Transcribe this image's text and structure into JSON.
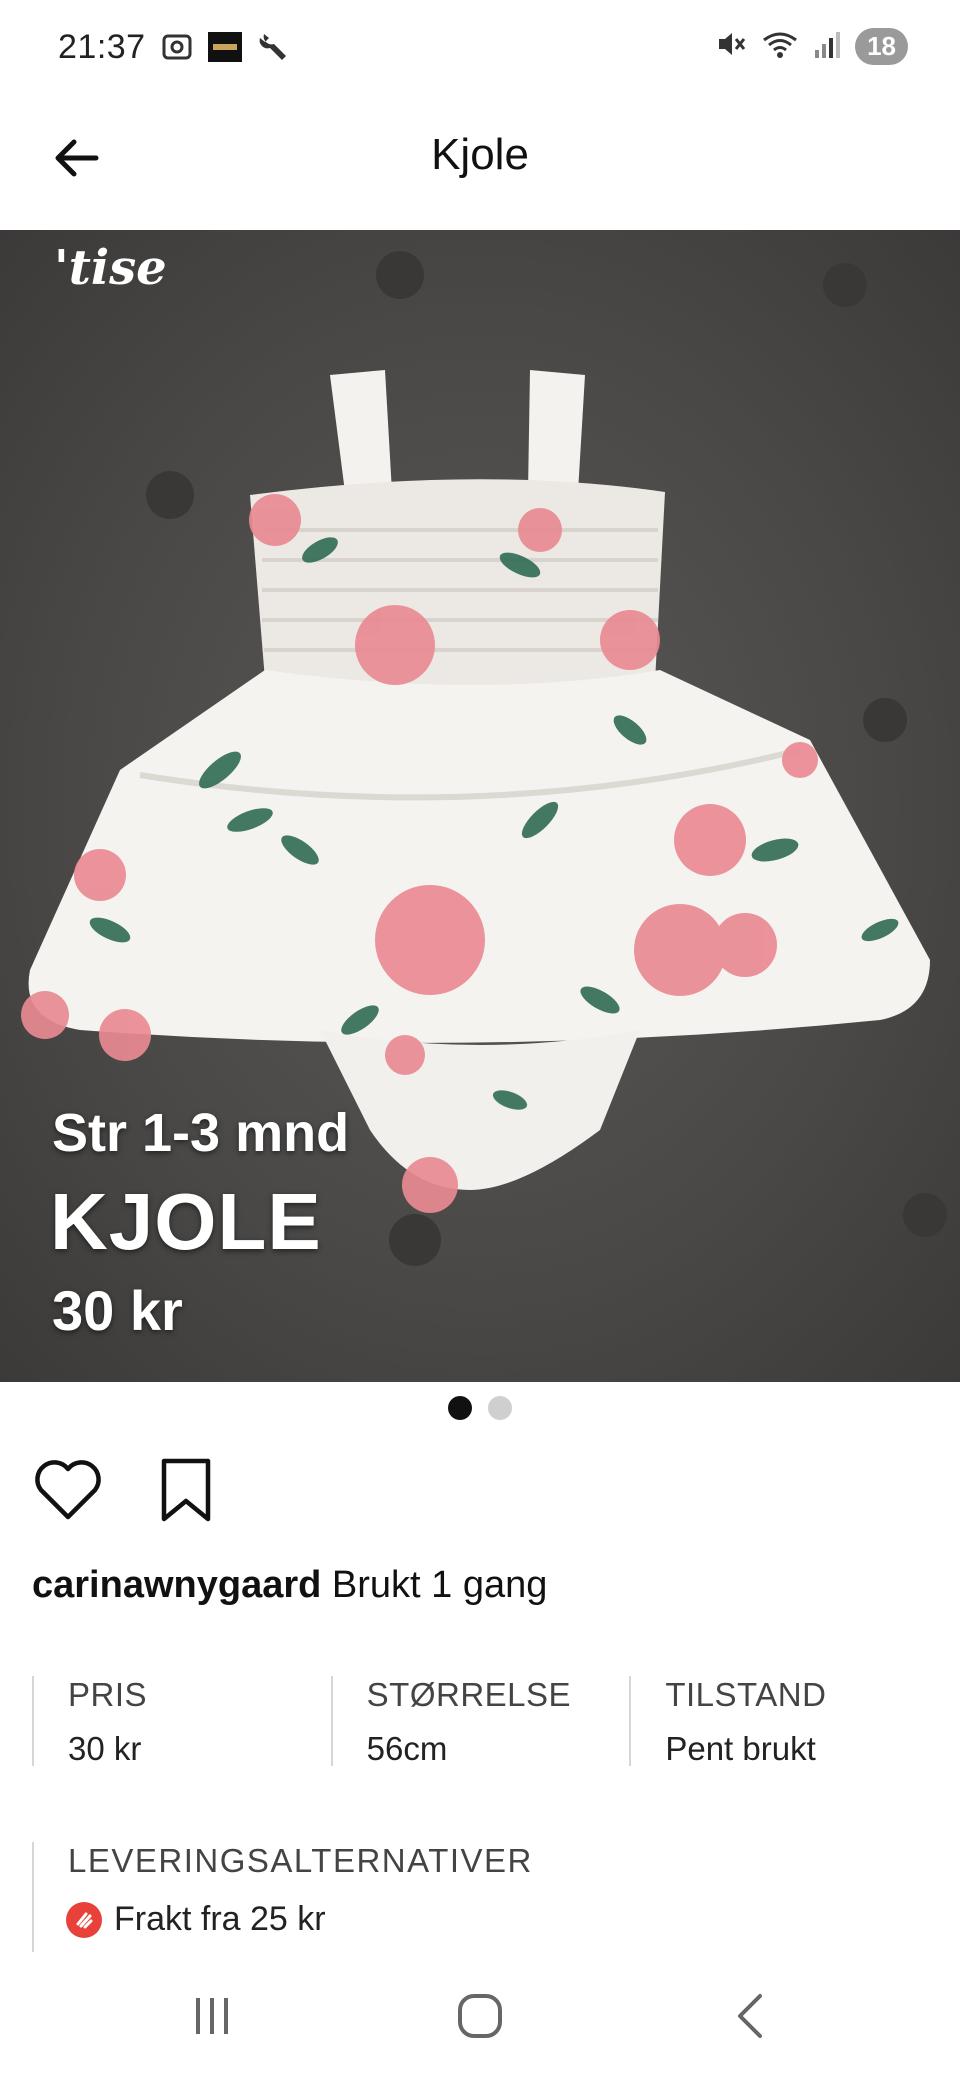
{
  "status_bar": {
    "time": "21:37",
    "left_icons": [
      "screenshot-icon",
      "app-thumbnail-icon",
      "wrench-icon"
    ],
    "right_icons": [
      "mute-icon",
      "wifi-icon",
      "signal-icon"
    ],
    "battery": "18"
  },
  "header": {
    "title": "Kjole",
    "back_icon": "arrow-left-icon"
  },
  "hero": {
    "brand_logo": "'tise",
    "overlay_size": "Str 1-3 mnd",
    "overlay_title": "KJOLE",
    "overlay_price": "30 kr",
    "image_count": 2,
    "active_image": 1
  },
  "actions": {
    "like_icon": "heart-icon",
    "save_icon": "bookmark-icon"
  },
  "listing": {
    "seller": "carinawnygaard",
    "description": "Brukt 1 gang"
  },
  "details": [
    {
      "label": "PRIS",
      "value": "30 kr"
    },
    {
      "label": "STØRRELSE",
      "value": "56cm"
    },
    {
      "label": "TILSTAND",
      "value": "Pent brukt"
    }
  ],
  "delivery": {
    "label": "LEVERINGSALTERNATIVER",
    "options": [
      {
        "icon": "shipping-icon",
        "text": "Frakt fra 25 kr"
      }
    ]
  },
  "nav_bar": {
    "buttons": [
      "recent-apps-icon",
      "home-icon",
      "back-icon"
    ]
  },
  "colors": {
    "accent": "#e8413a",
    "text": "#111111",
    "divider": "#d6d6d6"
  }
}
